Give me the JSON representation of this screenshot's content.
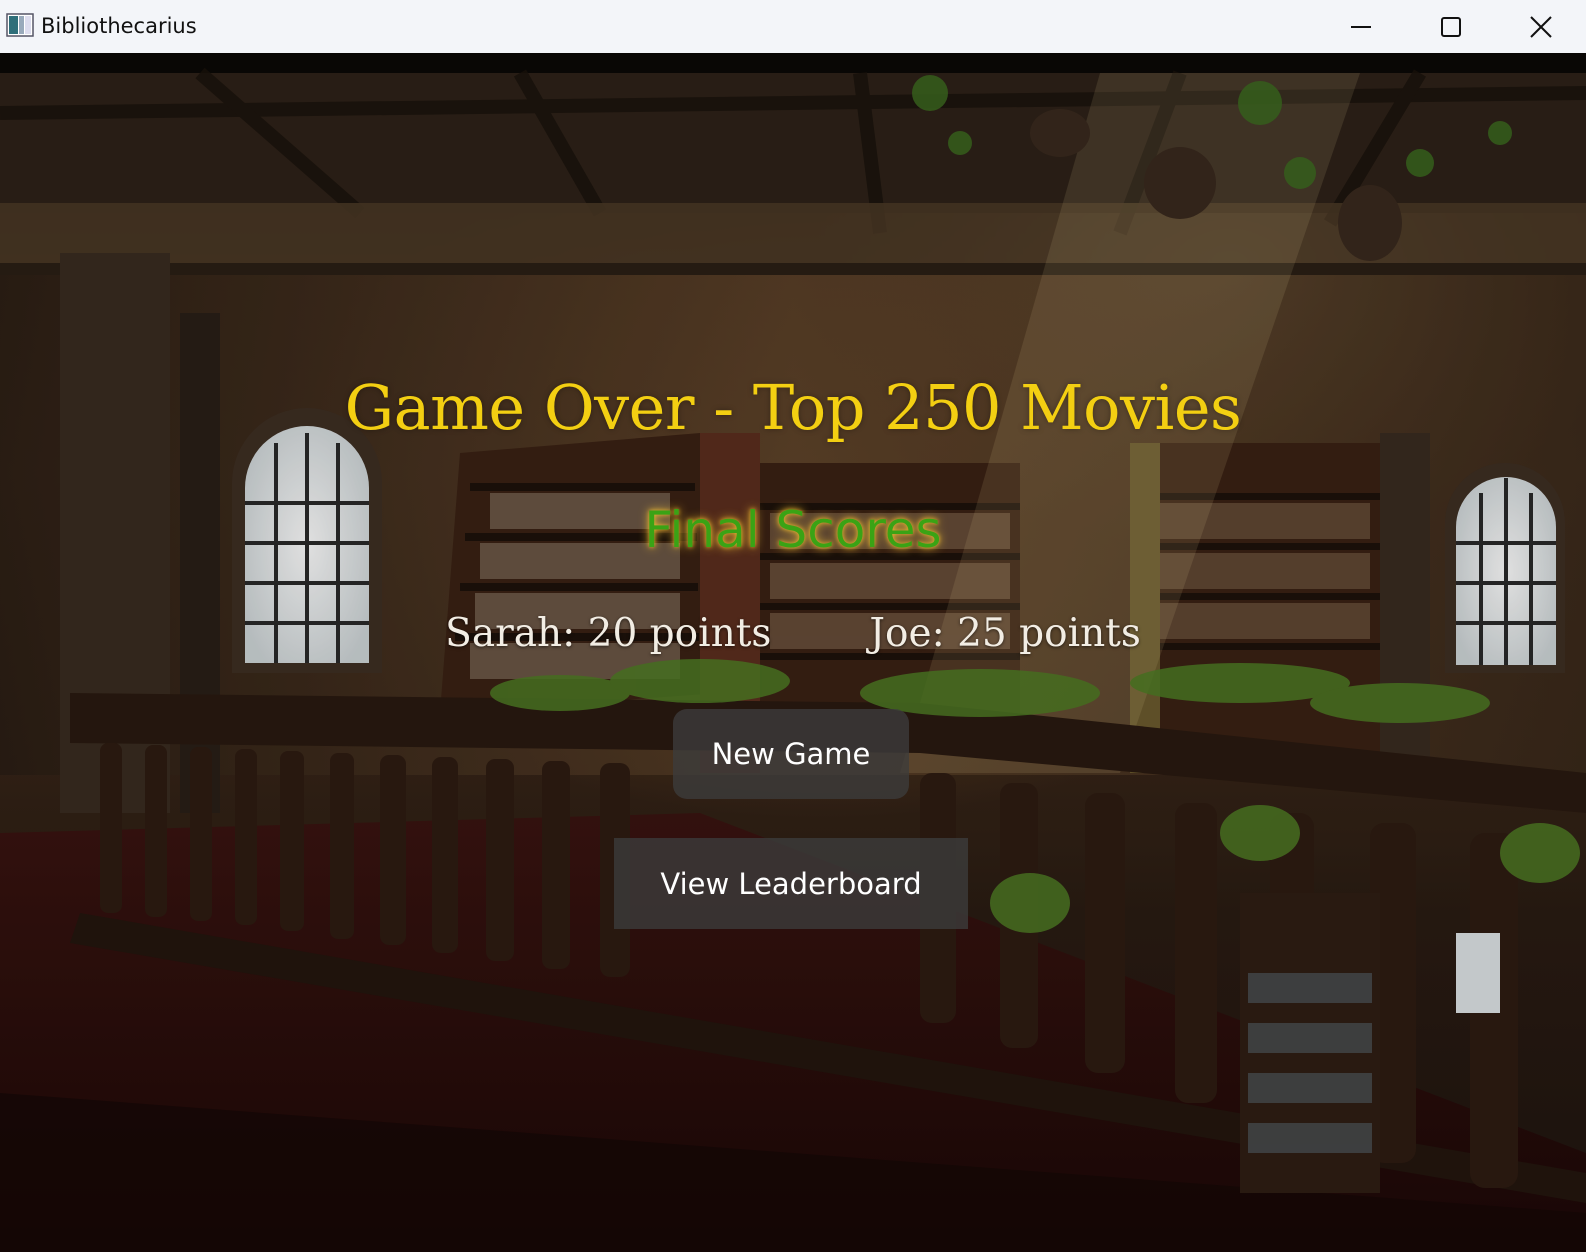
{
  "window": {
    "title": "Bibliothecarius",
    "minimize_icon": "minimize-icon",
    "maximize_icon": "maximize-icon",
    "close_icon": "close-icon"
  },
  "game_over": {
    "title": "Game Over - Top 250 Movies",
    "subtitle": "Final Scores",
    "scores": [
      {
        "text": "Sarah: 20 points"
      },
      {
        "text": "Joe: 25 points"
      }
    ]
  },
  "buttons": {
    "new_game": "New Game",
    "view_leaderboard": "View Leaderboard"
  },
  "colors": {
    "title": "#f3cf12",
    "subtitle": "#3aa315",
    "score_text": "#f2ede4",
    "button_bg": "#3c3c3c"
  }
}
